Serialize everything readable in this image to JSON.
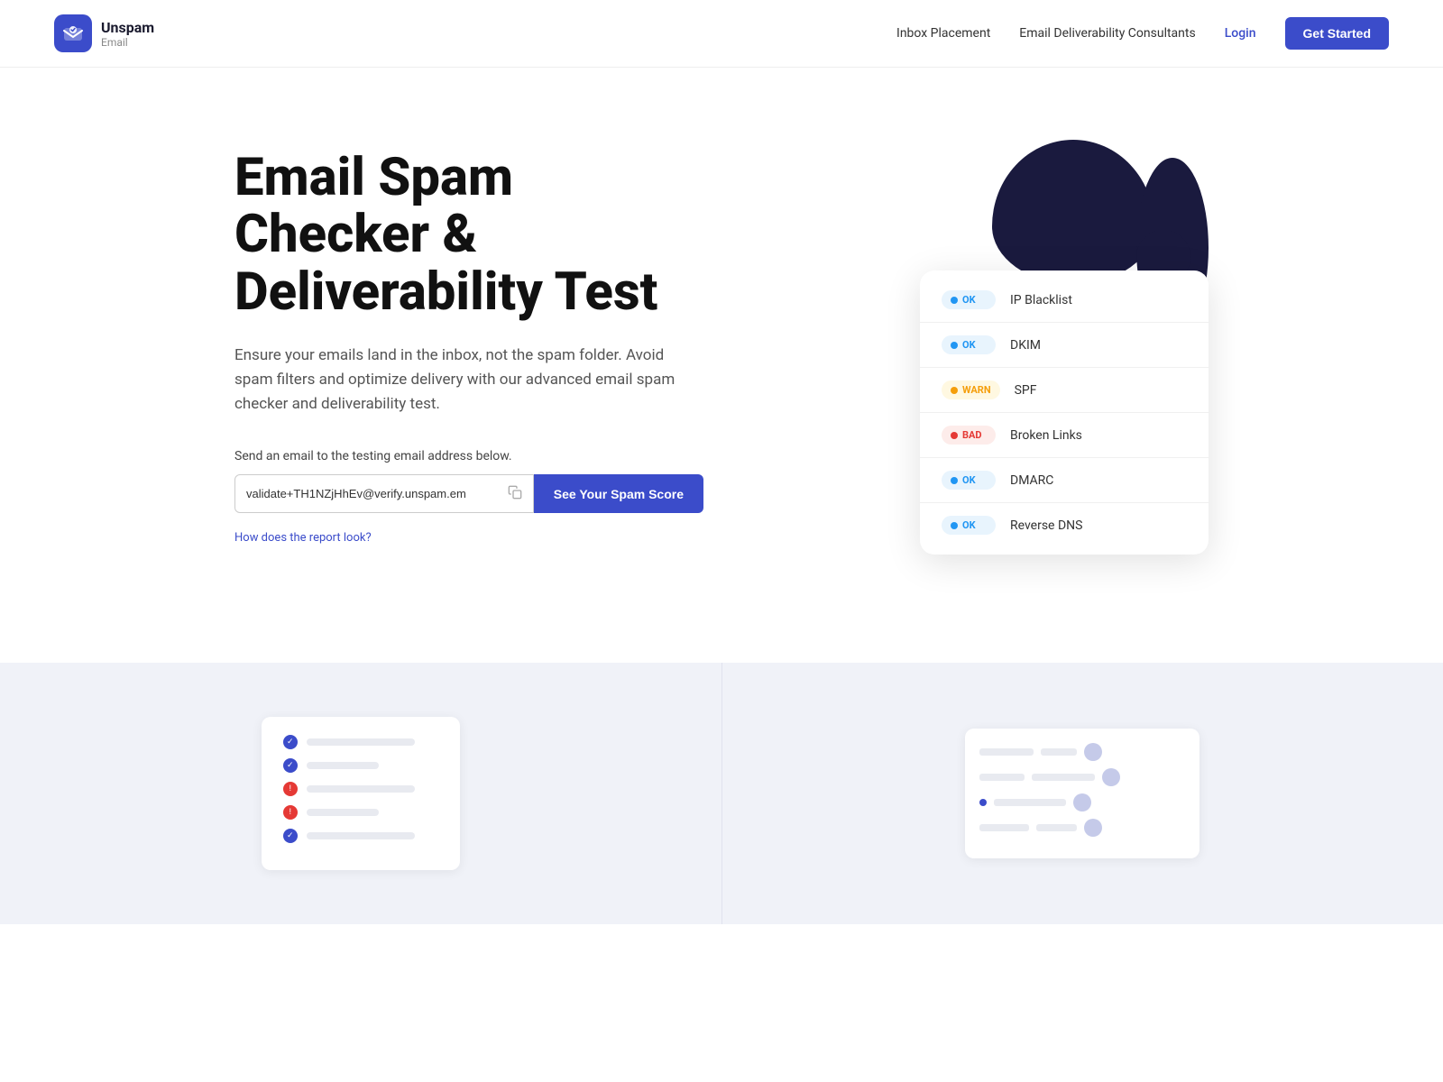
{
  "header": {
    "logo_name": "Unspam",
    "logo_sub": "Email",
    "nav": {
      "inbox_placement": "Inbox Placement",
      "consultants": "Email Deliverability Consultants",
      "login": "Login",
      "get_started": "Get Started"
    }
  },
  "hero": {
    "title_line1": "Email Spam",
    "title_line2": "Checker &",
    "title_line3": "Deliverability Test",
    "description": "Ensure your emails land in the inbox, not the spam folder. Avoid spam filters and optimize delivery with our advanced email spam checker and deliverability test.",
    "send_label": "Send an email to the testing email address below.",
    "email_value": "validate+TH1NZjHhEv@verify.unspam.em",
    "email_placeholder": "validate+TH1NZjHhEv@verify.unspam.em",
    "spam_btn_label": "See Your Spam Score",
    "report_link": "How does the report look?"
  },
  "results_card": {
    "rows": [
      {
        "status": "ok",
        "label": "IP Blacklist"
      },
      {
        "status": "ok",
        "label": "DKIM"
      },
      {
        "status": "warn",
        "label": "SPF"
      },
      {
        "status": "bad",
        "label": "Broken Links"
      },
      {
        "status": "ok",
        "label": "DMARC"
      },
      {
        "status": "ok",
        "label": "Reverse DNS"
      }
    ],
    "badge_ok": "OK",
    "badge_warn": "WARN",
    "badge_bad": "BAD"
  }
}
